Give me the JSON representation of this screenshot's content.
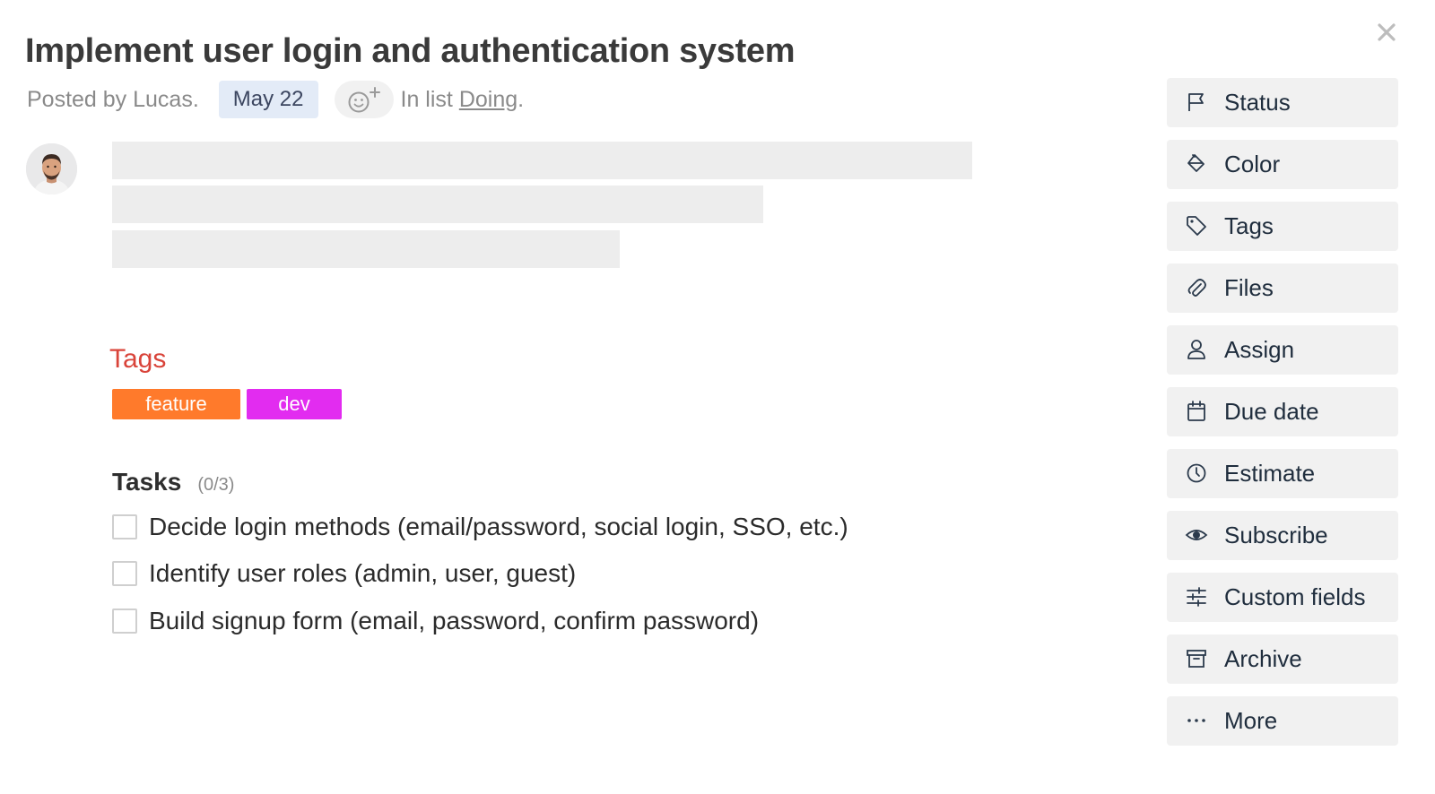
{
  "card": {
    "title": "Implement user login and authentication system",
    "posted_by": "Posted by Lucas.",
    "date": "May 22",
    "in_list_prefix": "In list",
    "list_name": "Doing",
    "list_suffix": "."
  },
  "tags": {
    "heading": "Tags",
    "items": [
      {
        "label": "feature",
        "color": "#ff7a2b"
      },
      {
        "label": "dev",
        "color": "#e22cf0"
      }
    ]
  },
  "tasks": {
    "heading": "Tasks",
    "count": "(0/3)",
    "items": [
      {
        "label": "Decide login methods (email/password, social login, SSO, etc.)",
        "checked": false
      },
      {
        "label": "Identify user roles (admin, user, guest)",
        "checked": false
      },
      {
        "label": "Build signup form (email, password, confirm password)",
        "checked": false
      }
    ]
  },
  "sidebar": {
    "items": [
      {
        "label": "Status",
        "icon": "flag-icon"
      },
      {
        "label": "Color",
        "icon": "paint-bucket-icon"
      },
      {
        "label": "Tags",
        "icon": "tag-icon"
      },
      {
        "label": "Files",
        "icon": "paperclip-icon"
      },
      {
        "label": "Assign",
        "icon": "user-icon"
      },
      {
        "label": "Due date",
        "icon": "calendar-icon"
      },
      {
        "label": "Estimate",
        "icon": "clock-icon"
      },
      {
        "label": "Subscribe",
        "icon": "eye-icon"
      },
      {
        "label": "Custom fields",
        "icon": "sliders-icon"
      },
      {
        "label": "Archive",
        "icon": "archive-icon"
      },
      {
        "label": "More",
        "icon": "more-icon"
      }
    ]
  },
  "colors": {
    "tags_heading": "#d9443a",
    "date_badge_bg": "#e3ebf7",
    "sidebar_button_bg": "#f1f1f1"
  }
}
